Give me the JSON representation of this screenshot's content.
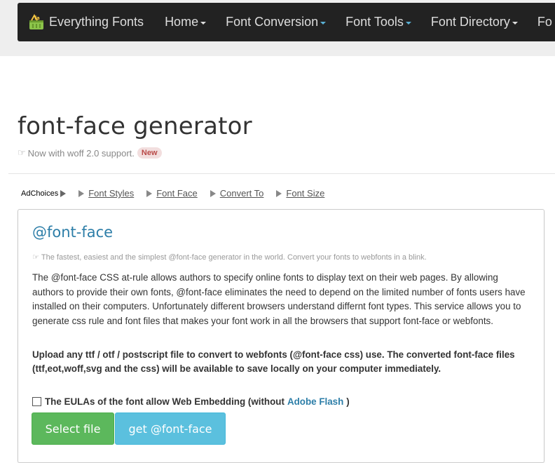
{
  "nav": {
    "brand": "Everything Fonts",
    "items": [
      {
        "label": "Home"
      },
      {
        "label": "Font Conversion"
      },
      {
        "label": "Font Tools"
      },
      {
        "label": "Font Directory"
      },
      {
        "label": "Fo"
      }
    ]
  },
  "header": {
    "title": "font-face generator",
    "subtitle": "Now with woff 2.0 support.",
    "badge": "New"
  },
  "ads": {
    "adchoices": "AdChoices",
    "links": [
      "Font Styles",
      "Font Face",
      "Convert To",
      "Font Size"
    ]
  },
  "panel": {
    "heading": "@font-face",
    "tagline": "The fastest, easiest and the simplest @font-face generator in the world. Convert your fonts to webfonts in a blink.",
    "description": "The @font-face CSS at-rule allows authors to specify online fonts to display text on their web pages. By allowing authors to provide their own fonts, @font-face eliminates the need to depend on the limited number of fonts users have installed on their computers. Unfortunately different browsers understand differnt font types. This service allows you to generate css rule and font files that makes your font work in all the browsers that support font-face or webfonts.",
    "upload_note": "Upload any ttf / otf / postscript file to convert to webfonts (@font-face css) use. The converted font-face files (ttf,eot,woff,svg and the css) will be available to save locally on your computer immediately.",
    "eula_prefix": "The EULAs of the font allow Web Embedding (without",
    "eula_link": "Adobe Flash",
    "eula_suffix": ")",
    "select_button": "Select file",
    "get_button": "get @font-face"
  },
  "colors": {
    "navbar": "#222222",
    "accent": "#2d7ea8",
    "select_button": "#5cb85c",
    "get_button": "#5bc0de"
  }
}
